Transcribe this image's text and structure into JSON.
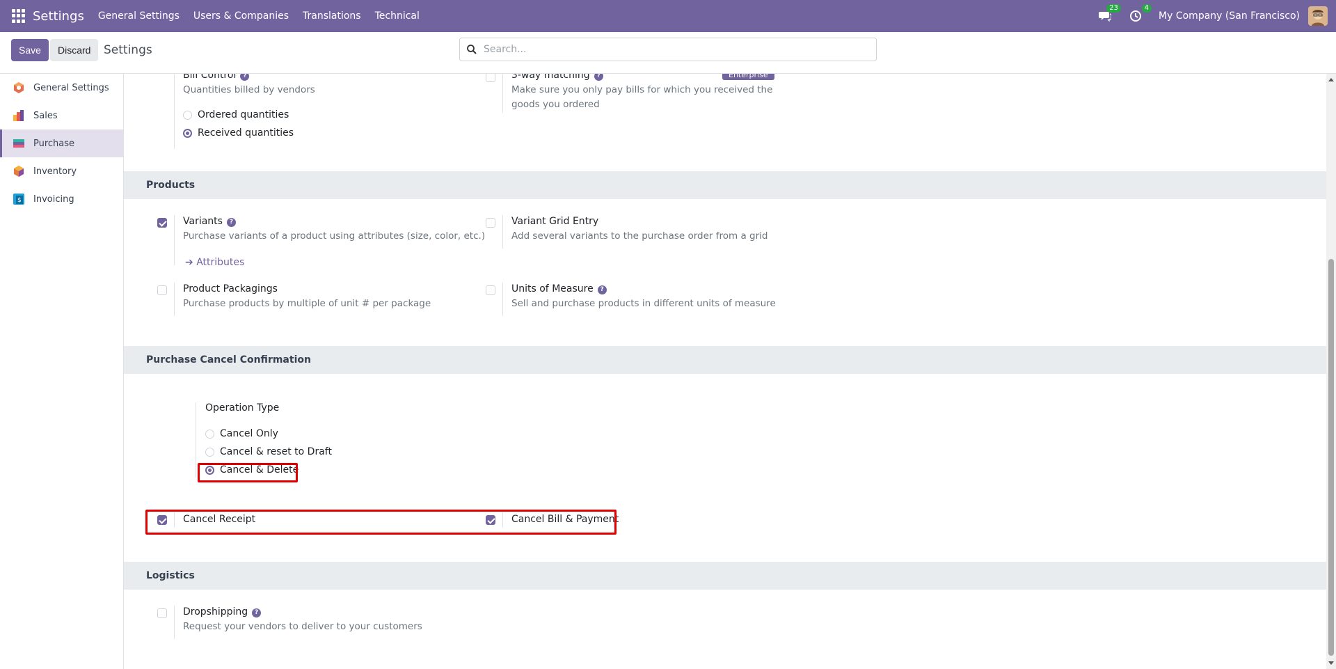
{
  "navbar": {
    "brand": "Settings",
    "menu": [
      "General Settings",
      "Users & Companies",
      "Translations",
      "Technical"
    ],
    "messages_count": "23",
    "activities_count": "4",
    "company": "My Company (San Francisco)",
    "bg_color": "#71639e"
  },
  "control": {
    "save_label": "Save",
    "discard_label": "Discard",
    "title": "Settings",
    "search_placeholder": "Search..."
  },
  "sidebar": {
    "items": [
      {
        "label": "General Settings",
        "icon": "general-settings-icon"
      },
      {
        "label": "Sales",
        "icon": "sales-icon"
      },
      {
        "label": "Purchase",
        "icon": "purchase-icon",
        "active": true
      },
      {
        "label": "Inventory",
        "icon": "inventory-icon"
      },
      {
        "label": "Invoicing",
        "icon": "invoicing-icon"
      }
    ]
  },
  "bill_control": {
    "title": "Bill Control",
    "desc": "Quantities billed by vendors",
    "options": [
      "Ordered quantities",
      "Received quantities"
    ],
    "selected": 1
  },
  "three_way": {
    "title": "3-way matching",
    "desc": "Make sure you only pay bills for which you received the goods you ordered",
    "badge": "Enterprise",
    "checked": false
  },
  "products": {
    "heading": "Products",
    "variants": {
      "title": "Variants",
      "desc": "Purchase variants of a product using attributes (size, color, etc.)",
      "link": "Attributes",
      "checked": true
    },
    "variant_grid": {
      "title": "Variant Grid Entry",
      "desc": "Add several variants to the purchase order from a grid",
      "checked": false
    },
    "packagings": {
      "title": "Product Packagings",
      "desc": "Purchase products by multiple of unit # per package",
      "checked": false
    },
    "uom": {
      "title": "Units of Measure",
      "desc": "Sell and purchase products in different units of measure",
      "checked": false
    }
  },
  "cancel_conf": {
    "heading": "Purchase Cancel Confirmation",
    "operation_label": "Operation Type",
    "options": [
      "Cancel Only",
      "Cancel & reset to Draft",
      "Cancel & Delete"
    ],
    "selected": 2,
    "cancel_receipt": {
      "title": "Cancel Receipt",
      "checked": true
    },
    "cancel_bill": {
      "title": "Cancel Bill & Payment",
      "checked": true
    }
  },
  "logistics": {
    "heading": "Logistics",
    "dropshipping": {
      "title": "Dropshipping",
      "desc": "Request your vendors to deliver to your customers",
      "checked": false
    }
  },
  "colors": {
    "accent": "#71639e",
    "highlight": "#e00000",
    "section_bg": "#e9ecef"
  }
}
